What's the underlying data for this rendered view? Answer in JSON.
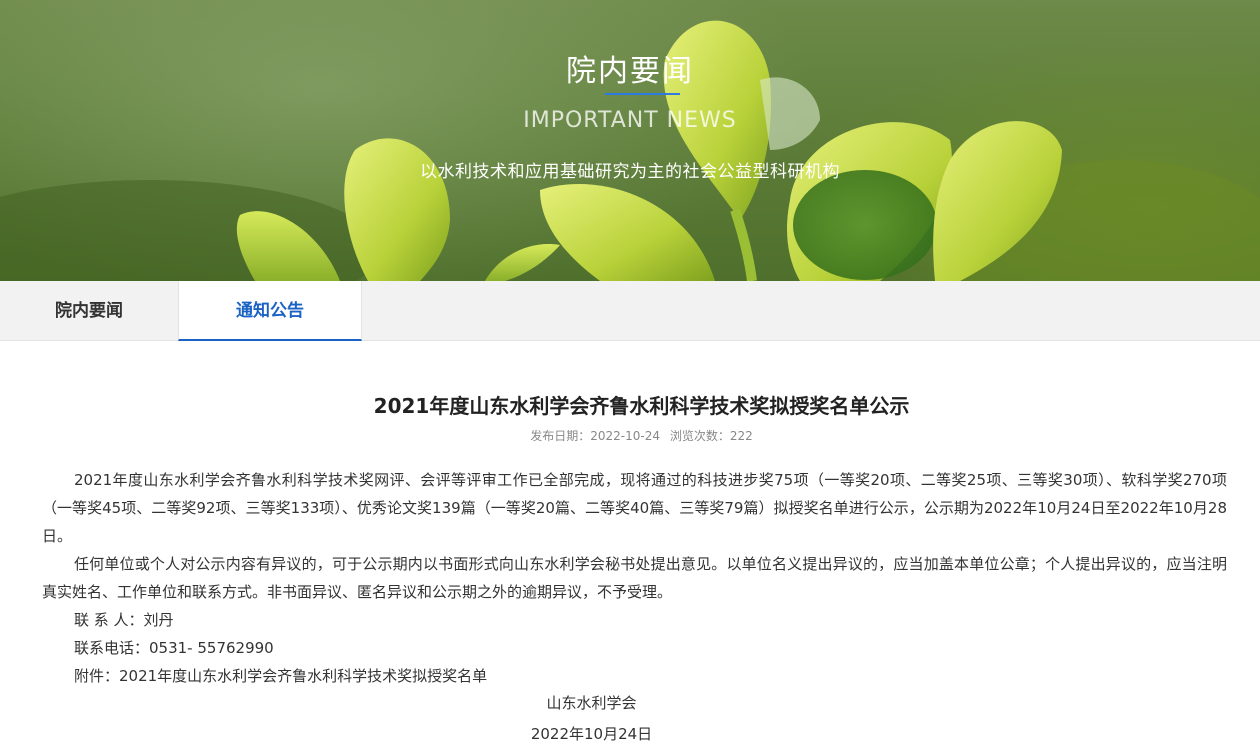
{
  "banner": {
    "title": "院内要闻",
    "subtitle": "IMPORTANT NEWS",
    "description": "以水利技术和应用基础研究为主的社会公益型科研机构"
  },
  "tabs": [
    {
      "label": "院内要闻",
      "active": false
    },
    {
      "label": "通知公告",
      "active": true
    }
  ],
  "article": {
    "title": "2021年度山东水利学会齐鲁水利科学技术奖拟授奖名单公示",
    "meta": {
      "date_label": "发布日期：",
      "date": "2022-10-24",
      "views_label": "浏览次数：",
      "views": "222"
    },
    "paragraphs": [
      "2021年度山东水利学会齐鲁水利科学技术奖网评、会评等评审工作已全部完成，现将通过的科技进步奖75项（一等奖20项、二等奖25项、三等奖30项）、软科学奖270项（一等奖45项、二等奖92项、三等奖133项）、优秀论文奖139篇（一等奖20篇、二等奖40篇、三等奖79篇）拟授奖名单进行公示，公示期为2022年10月24日至2022年10月28日。",
      "任何单位或个人对公示内容有异议的，可于公示期内以书面形式向山东水利学会秘书处提出意见。以单位名义提出异议的，应当加盖本单位公章；个人提出异议的，应当注明真实姓名、工作单位和联系方式。非书面异议、匿名异议和公示期之外的逾期异议，不予受理。",
      "联 系 人：刘丹",
      "联系电话：0531- 55762990",
      "附件：2021年度山东水利学会齐鲁水利科学技术奖拟授奖名单"
    ],
    "signature": "山东水利学会",
    "sign_date": "2022年10月24日"
  },
  "colors": {
    "accent": "#1a63c4",
    "banner_line": "#2d7be0",
    "tab_bg": "#f2f2f2"
  }
}
